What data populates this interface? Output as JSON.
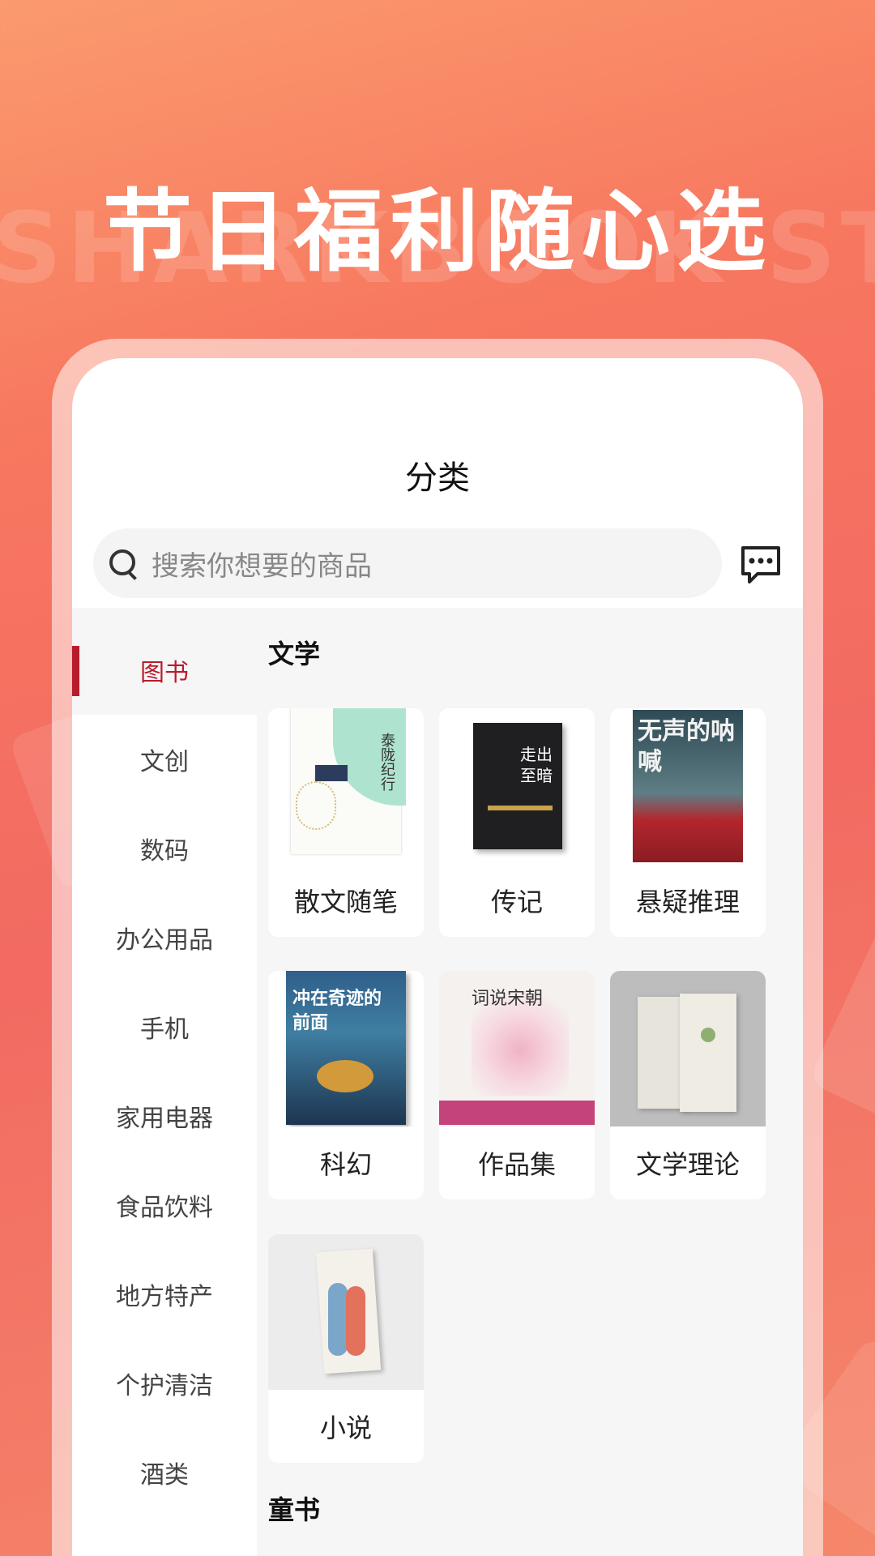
{
  "banner": {
    "headline": "节日福利随心选",
    "watermark": "SHARKBOOK STO"
  },
  "page": {
    "title": "分类"
  },
  "search": {
    "placeholder": "搜索你想要的商品"
  },
  "icons": {
    "search": "search-icon",
    "message": "message-icon"
  },
  "colors": {
    "accent": "#b81c2c",
    "background_gradient": [
      "#fb9a6e",
      "#f26a62"
    ]
  },
  "sidebar": {
    "items": [
      {
        "label": "图书",
        "active": true
      },
      {
        "label": "文创"
      },
      {
        "label": "数码"
      },
      {
        "label": "办公用品"
      },
      {
        "label": "手机"
      },
      {
        "label": "家用电器"
      },
      {
        "label": "食品饮料"
      },
      {
        "label": "地方特产"
      },
      {
        "label": "个护清洁"
      },
      {
        "label": "酒类"
      }
    ]
  },
  "sections": [
    {
      "title": "文学",
      "items": [
        {
          "label": "散文随笔",
          "cover_text": "泰陇纪行"
        },
        {
          "label": "传记",
          "cover_text": "走出至暗"
        },
        {
          "label": "悬疑推理",
          "cover_text": "无声的呐喊"
        },
        {
          "label": "科幻",
          "cover_text": "冲在奇迹的前面"
        },
        {
          "label": "作品集",
          "cover_text": "词说宋朝"
        },
        {
          "label": "文学理论"
        },
        {
          "label": "小说"
        }
      ]
    },
    {
      "title": "童书",
      "items": []
    }
  ]
}
